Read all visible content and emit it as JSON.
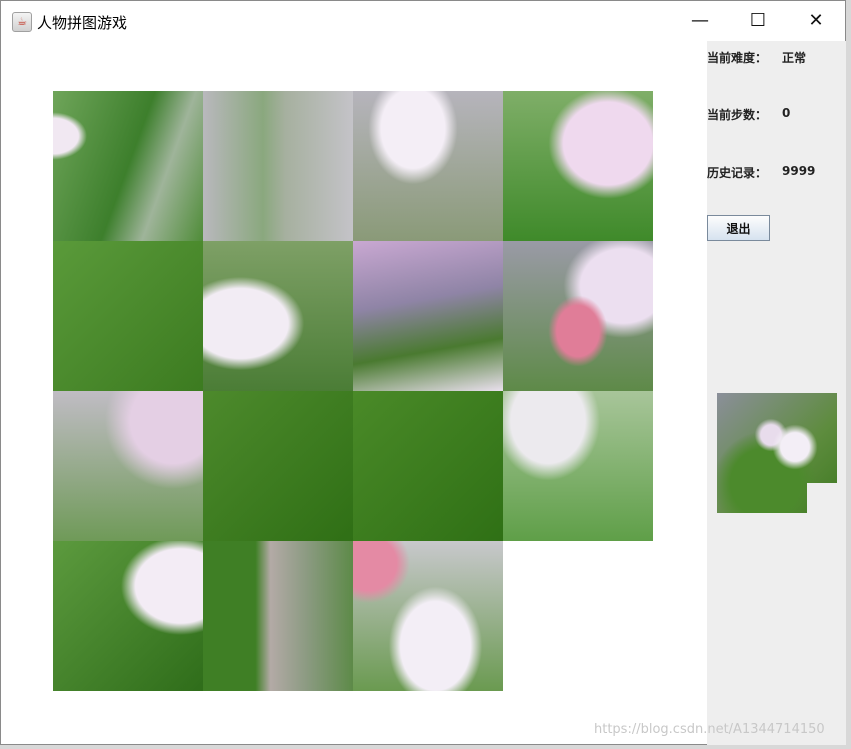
{
  "window": {
    "title": "人物拼图游戏",
    "app_icon": "java-icon",
    "controls": {
      "minimize": "—",
      "maximize": "☐",
      "close": "✕"
    }
  },
  "panel": {
    "difficulty_label": "当前难度：",
    "difficulty_value": "正常",
    "steps_label": "当前步数：",
    "steps_value": "0",
    "record_label": "历史记录：",
    "record_value": "9999",
    "exit_button": "退出"
  },
  "watermark": "https://blog.csdn.net/A1344714150"
}
